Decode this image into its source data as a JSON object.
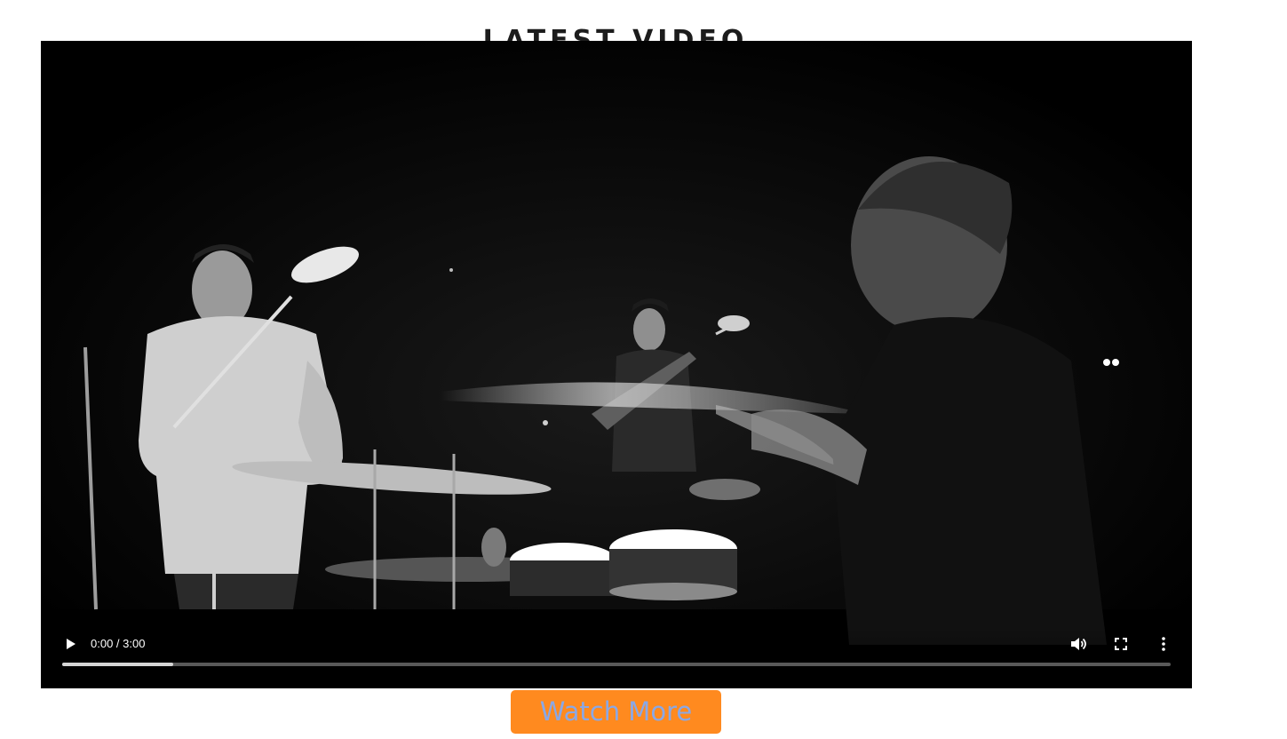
{
  "section": {
    "title": "LATEST VIDEO"
  },
  "video": {
    "time_display": "0:00 / 3:00",
    "buffered_fraction": 0.1,
    "icons": {
      "play": "play-icon",
      "volume": "volume-icon",
      "fullscreen": "fullscreen-icon",
      "more": "more-options-icon"
    }
  },
  "cta": {
    "label": "Watch More",
    "background_color": "#ff8a1f",
    "text_color": "#8aa8e6"
  }
}
